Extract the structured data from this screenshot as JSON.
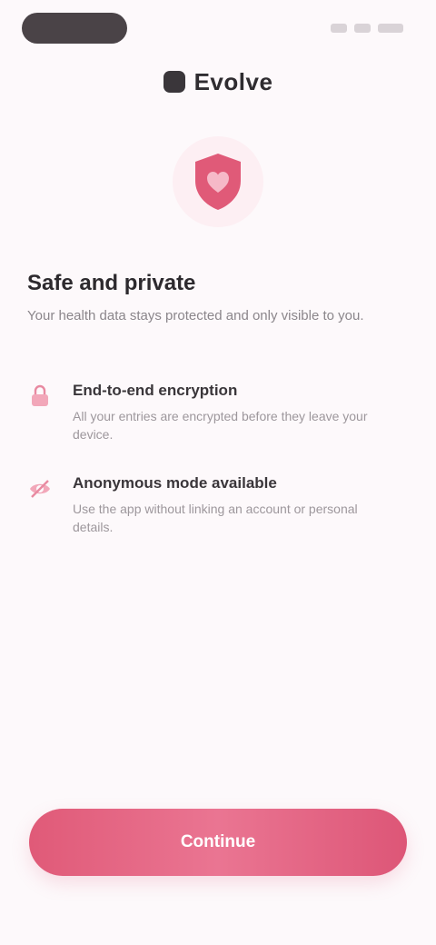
{
  "status_bar": {
    "icons": [
      "signal-icon",
      "wifi-icon",
      "battery-icon"
    ]
  },
  "brand": {
    "name": "Evolve",
    "icon": "brand-logo-icon"
  },
  "hero": {
    "icon": "shield-heart-icon"
  },
  "intro": {
    "title": "Safe and private",
    "subtitle": "Your health data stays protected and only visible to you."
  },
  "features": [
    {
      "icon": "lock-icon",
      "title": "End-to-end encryption",
      "description": "All your entries are encrypted before they leave your device."
    },
    {
      "icon": "eye-off-icon",
      "title": "Anonymous mode available",
      "description": "Use the app without linking an account or personal details."
    }
  ],
  "cta": {
    "label": "Continue"
  },
  "colors": {
    "accent": "#e05a78",
    "background": "#fdf9fb",
    "text": "#2b2a2e"
  }
}
